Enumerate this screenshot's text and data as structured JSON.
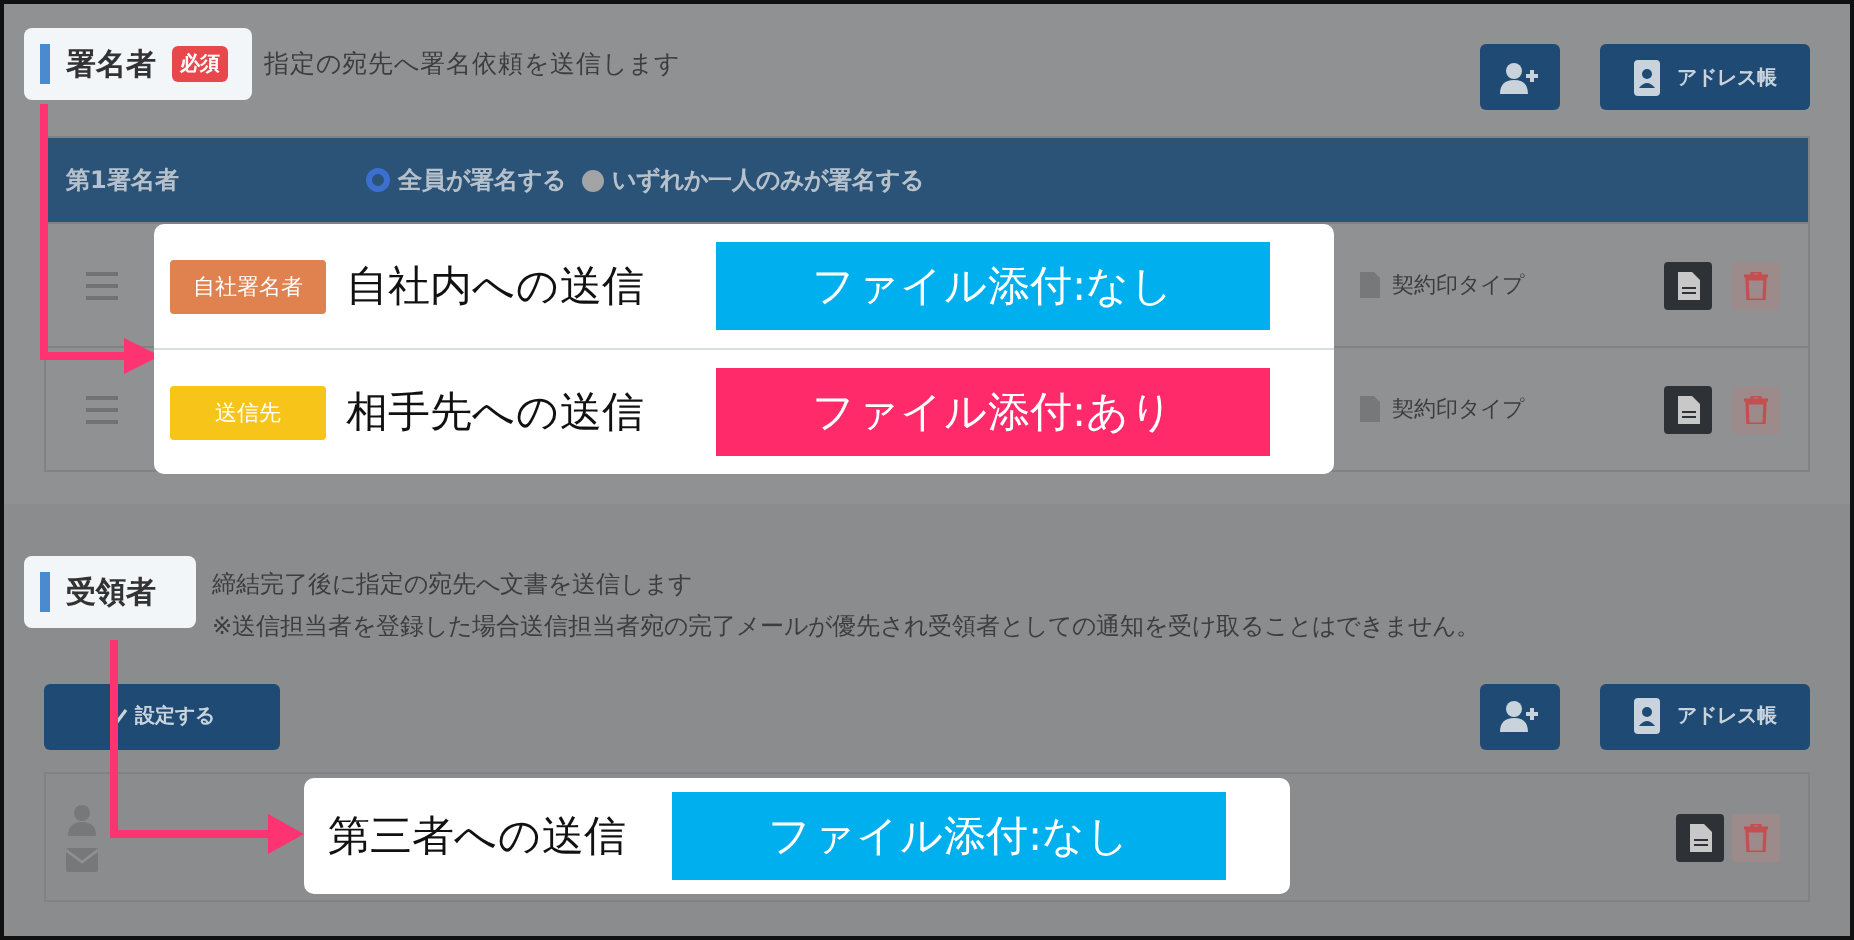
{
  "signers": {
    "title": "署名者",
    "required_badge": "必須",
    "description": "指定の宛先へ署名依頼を送信します",
    "address_book_button": "アドレス帳",
    "table": {
      "heading": "第1署名者",
      "options": [
        {
          "label": "全員が署名する",
          "selected": true
        },
        {
          "label": "いずれか一人のみが署名する",
          "selected": false
        }
      ],
      "rows": [
        {
          "stamp_type": "契約印タイプ"
        },
        {
          "stamp_type": "契約印タイプ"
        }
      ]
    }
  },
  "recipients": {
    "title": "受領者",
    "description": [
      "締結完了後に指定の宛先へ文書を送信します",
      "※送信担当者を登録した場合送信担当者宛の完了メールが優先され受領者としての通知を受け取ることはできません。"
    ],
    "set_button": "設定する",
    "address_book_button": "アドレス帳"
  },
  "callouts": [
    {
      "rows": [
        {
          "tag": {
            "label": "自社署名者",
            "color": "#e0824f"
          },
          "text": "自社内への送信",
          "attachment": {
            "label": "ファイル添付:なし",
            "color": "#00b0ee"
          }
        },
        {
          "tag": {
            "label": "送信先",
            "color": "#f7c51a"
          },
          "text": "相手先への送信",
          "attachment": {
            "label": "ファイル添付:あり",
            "color": "#ff2a6a"
          }
        }
      ]
    },
    {
      "rows": [
        {
          "text": "第三者への送信",
          "attachment": {
            "label": "ファイル添付:なし",
            "color": "#00b0ee"
          }
        }
      ]
    }
  ]
}
